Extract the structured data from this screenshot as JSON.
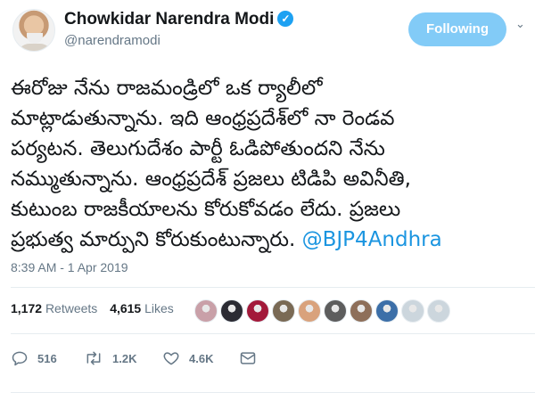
{
  "author": {
    "display_name": "Chowkidar Narendra Modi",
    "handle": "@narendramodi",
    "verified_glyph": "✓",
    "avatar": "avatar-photo"
  },
  "follow_button": {
    "label": "Following"
  },
  "more_menu": {
    "glyph": "⌄"
  },
  "tweet": {
    "lines": [
      "ఈరోజు నేను రాజమండ్రిలో ఒక ర్యాలీలో",
      "మాట్లాడుతున్నాను. ఇది ఆంధ్రప్రదేశ్‌లో నా రెండవ",
      "పర్యటన. తెలుగుదేశం పార్టీ ఓడిపోతుందని నేను",
      "నమ్ముతున్నాను. ఆంధ్రప్రదేశ్ ప్రజలు టిడిపి అవినీతి,",
      "కుటుంబ రాజకీయాలను కోరుకోవడం లేదు. ప్రజలు"
    ],
    "last_line_text": "ప్రభుత్వ మార్పుని కోరుకుంటున్నారు.",
    "mention": "@BJP4Andhra",
    "timestamp": "8:39 AM - 1 Apr 2019"
  },
  "stats": {
    "retweets_count": "1,172",
    "retweets_label": "Retweets",
    "likes_count": "4,615",
    "likes_label": "Likes"
  },
  "likers": [
    {
      "icon": "liker-avatar-1",
      "color": "#c9a0a8"
    },
    {
      "icon": "liker-avatar-2",
      "color": "#2b2b33"
    },
    {
      "icon": "liker-avatar-3",
      "color": "#a3193a"
    },
    {
      "icon": "liker-avatar-4",
      "color": "#7a6a55"
    },
    {
      "icon": "liker-avatar-5",
      "color": "#d9a27c"
    },
    {
      "icon": "liker-avatar-6",
      "color": "#5d5d5d"
    },
    {
      "icon": "liker-avatar-7",
      "color": "#8e6f5a"
    },
    {
      "icon": "liker-avatar-8",
      "color": "#3c6fa8"
    },
    {
      "icon": "liker-avatar-9",
      "color": "#ccd6dd"
    },
    {
      "icon": "liker-avatar-10",
      "color": "#ccd6dd"
    }
  ],
  "actions": {
    "reply": {
      "icon": "reply-icon",
      "count": "516"
    },
    "retweet": {
      "icon": "retweet-icon",
      "count": "1.2K"
    },
    "like": {
      "icon": "heart-icon",
      "count": "4.6K"
    },
    "dm": {
      "icon": "direct-message-icon"
    }
  },
  "colors": {
    "accent": "#1da1f2",
    "mention": "#1b95e0",
    "muted": "#657786",
    "divider": "#e6ecf0"
  }
}
